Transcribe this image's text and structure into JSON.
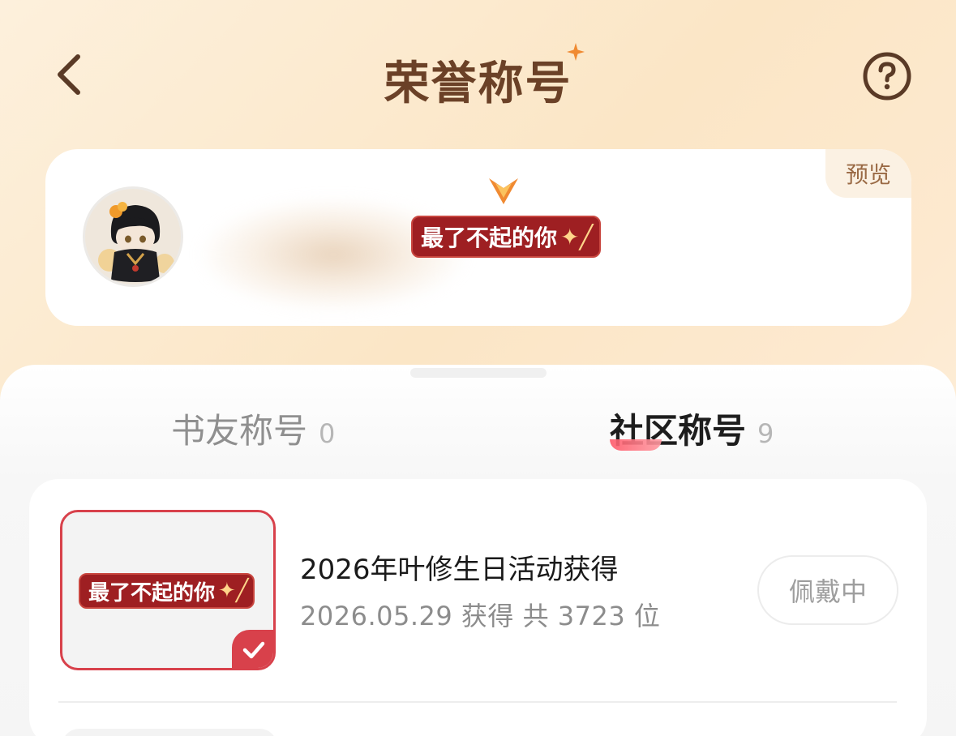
{
  "header": {
    "title": "荣誉称号",
    "back_icon": "chevron-left-icon",
    "help_icon": "question-circle-icon"
  },
  "preview": {
    "tag_label": "预览",
    "badge_text": "最了不起的你",
    "badge_icon": "sparkle-wand-icon"
  },
  "tabs": [
    {
      "label": "书友称号",
      "count": "0"
    },
    {
      "label": "社区称号",
      "count": "9"
    }
  ],
  "list": {
    "items": [
      {
        "badge_text": "最了不起的你",
        "title": "2026年叶修生日活动获得",
        "subtitle": "2026.05.29 获得 共 3723 位",
        "action_label": "佩戴中",
        "selected": true
      }
    ]
  },
  "colors": {
    "title_brown": "#6b4127",
    "badge_red": "#9e1f22",
    "accent_red": "#d8414b",
    "tag_text": "#9a6a45"
  }
}
